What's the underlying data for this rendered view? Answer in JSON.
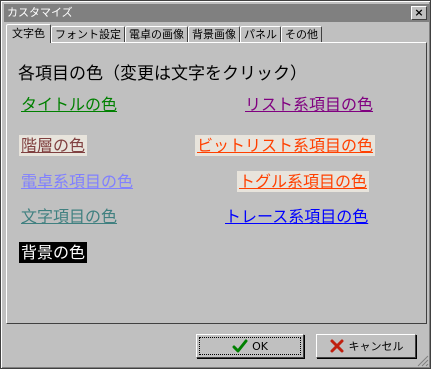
{
  "window": {
    "title": "カスタマイズ",
    "close_label": "×"
  },
  "tabs": [
    {
      "label": "文字色",
      "active": true
    },
    {
      "label": "フォント設定",
      "active": false
    },
    {
      "label": "電卓の画像",
      "active": false
    },
    {
      "label": "背景画像",
      "active": false
    },
    {
      "label": "パネル",
      "active": false
    },
    {
      "label": "その他",
      "active": false
    }
  ],
  "panel": {
    "heading": "各項目の色（変更は文字をクリック）",
    "items": [
      {
        "label": "タイトルの色",
        "color": "#008000",
        "bg": "#c0c0c0"
      },
      {
        "label": "リスト系項目の色",
        "color": "#800080",
        "bg": "#c0c0c0"
      },
      {
        "label": "階層の色",
        "color": "#804040",
        "bg": "#e8e4dc"
      },
      {
        "label": "ビットリスト系項目の色",
        "color": "#ff4000",
        "bg": "#e8e4dc"
      },
      {
        "label": "電卓系項目の色",
        "color": "#8080ff",
        "bg": "#c0c0c0"
      },
      {
        "label": "トグル系項目の色",
        "color": "#ff4000",
        "bg": "#e8e4dc"
      },
      {
        "label": "文字項目の色",
        "color": "#408080",
        "bg": "#c0c0c0"
      },
      {
        "label": "トレース系項目の色",
        "color": "#0000ff",
        "bg": "#c0c0c0"
      },
      {
        "label": "背景の色",
        "color": "#ffffff",
        "bg": "#000000"
      }
    ]
  },
  "buttons": {
    "ok_label": "OK",
    "cancel_label": "キャンセル",
    "ok_icon": "checkmark-icon",
    "cancel_icon": "x-mark-icon"
  }
}
